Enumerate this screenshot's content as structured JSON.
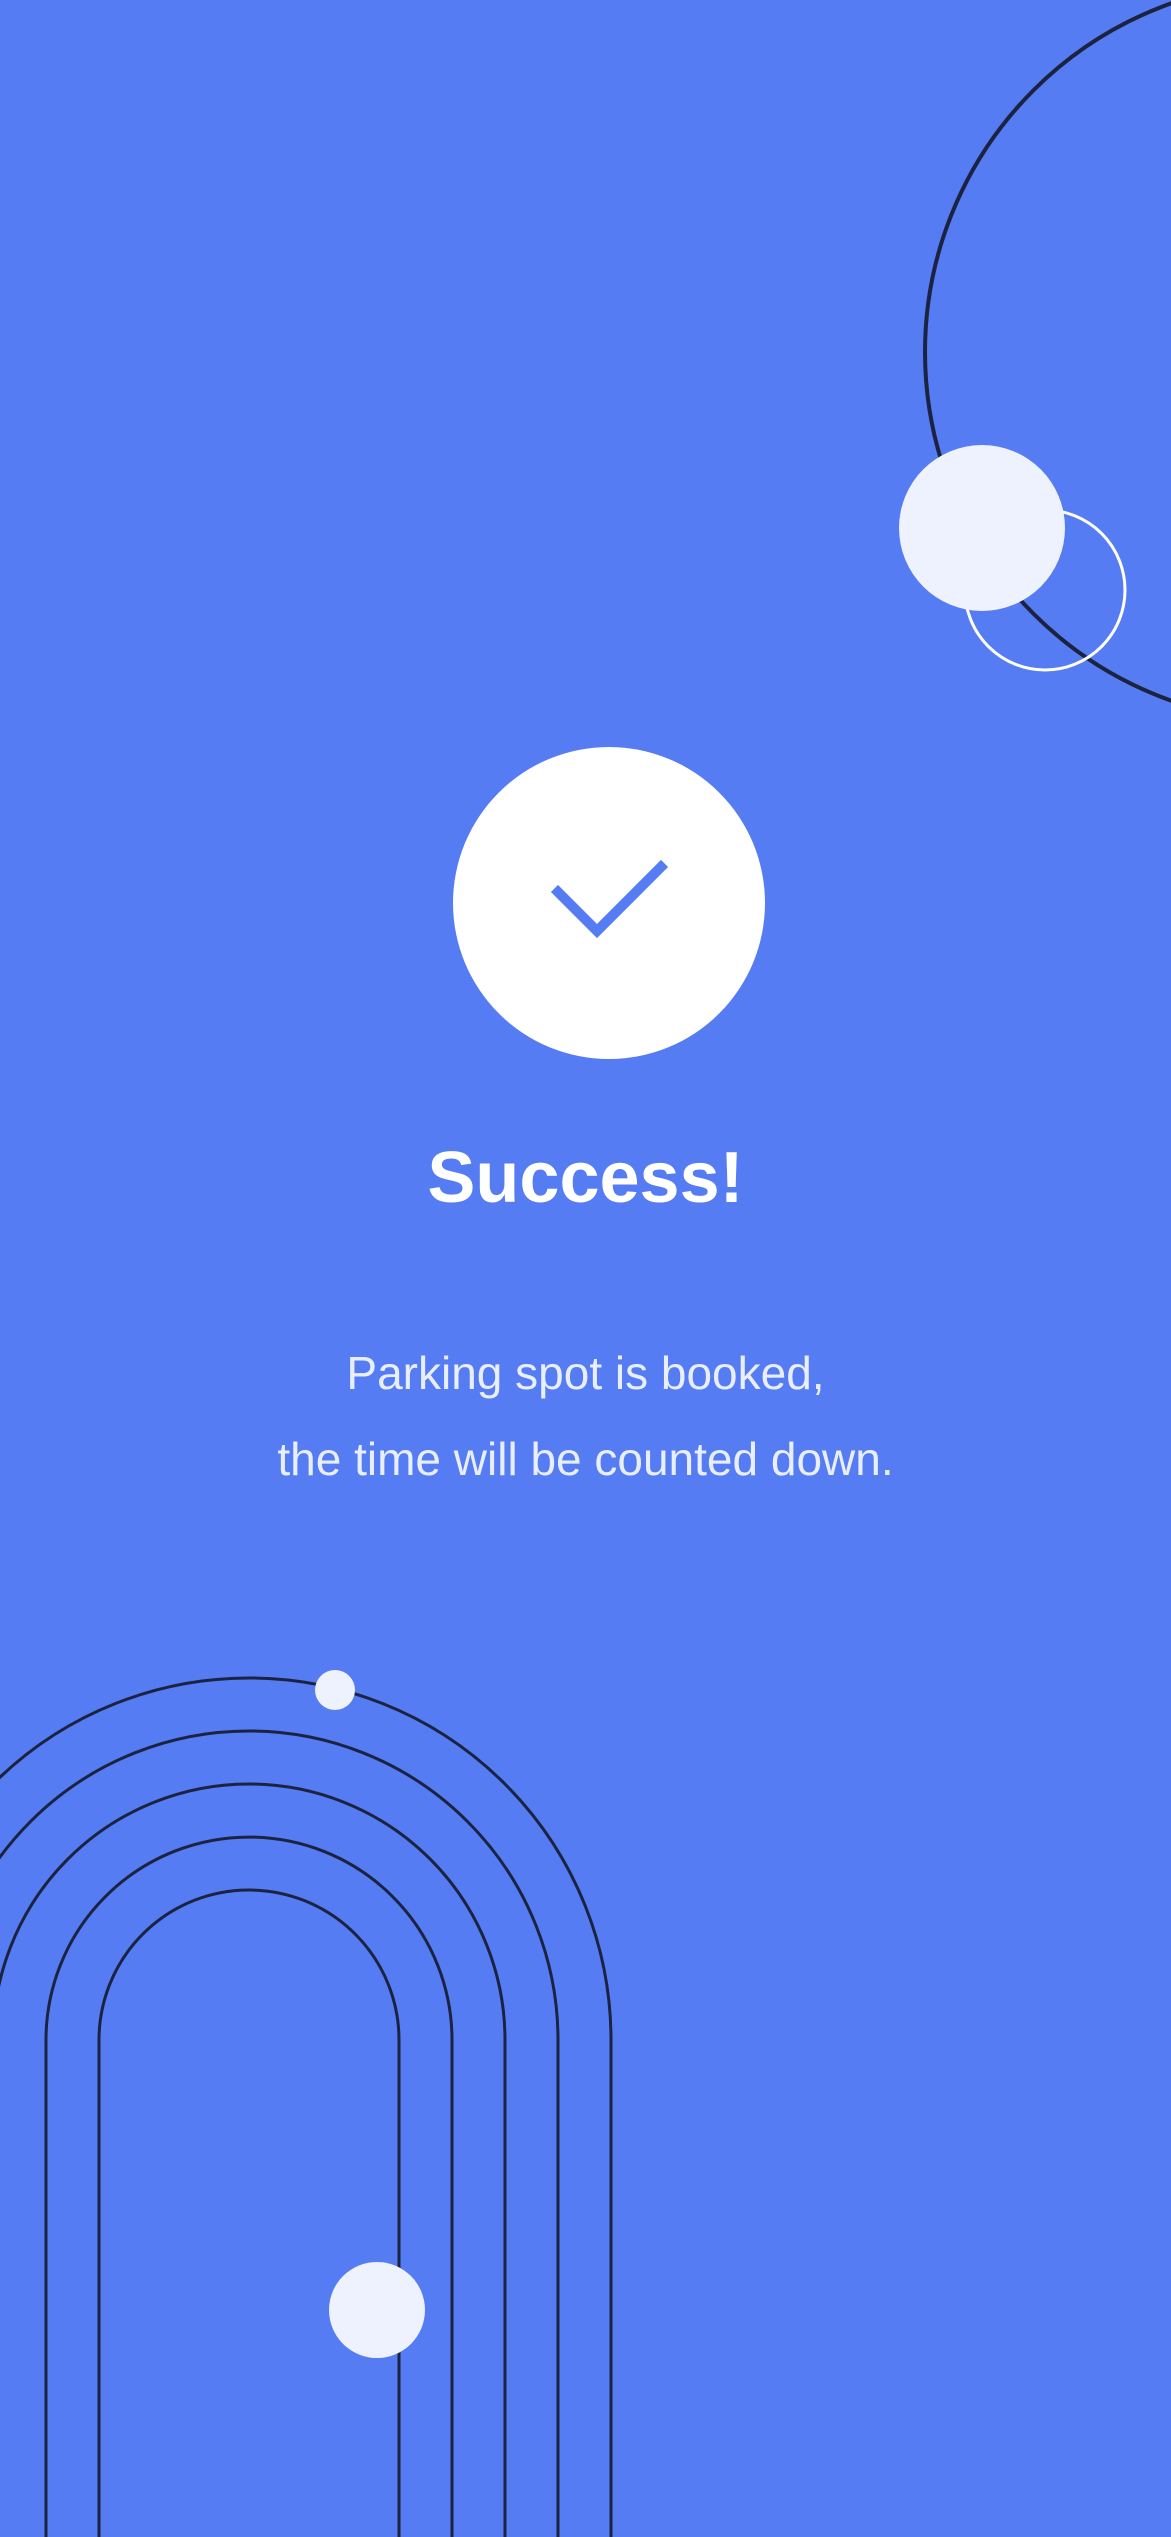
{
  "colors": {
    "background": "#557CF3",
    "badge": "#FFFFFF",
    "checkmark": "#557CF3",
    "title": "#FFFFFF",
    "message": "#E9EEFD",
    "decor_line": "#1C2340",
    "decor_dot": "#EEF2FE"
  },
  "icons": {
    "success": "checkmark-icon"
  },
  "content": {
    "title": "Success!",
    "message_line_1": "Parking spot is booked,",
    "message_line_2": "the time will be counted down."
  }
}
